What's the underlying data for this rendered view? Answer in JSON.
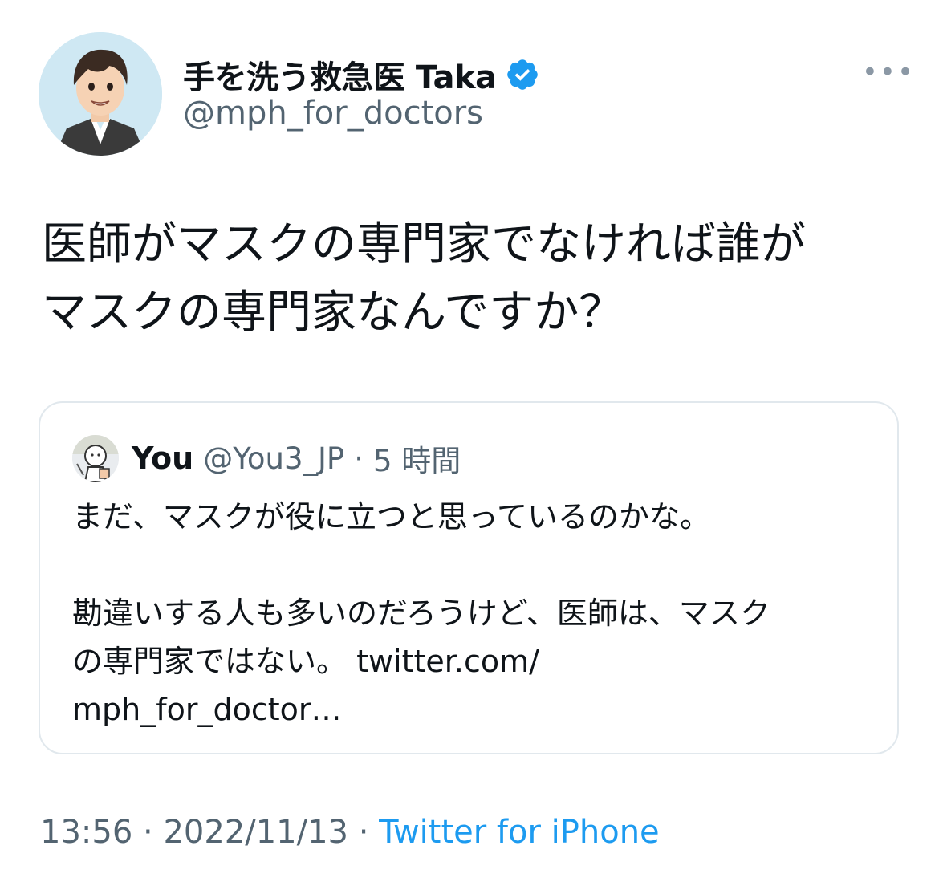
{
  "author": {
    "display_name": "手を洗う救急医 Taka",
    "handle": "@mph_for_doctors",
    "verified": true,
    "avatar_icon": "anime-doctor-avatar"
  },
  "more_label": "•••",
  "tweet": {
    "lines": [
      "医師がマスクの専門家でなければ誰が",
      "マスクの専門家なんですか？"
    ]
  },
  "quote": {
    "name": "You",
    "handle": "@You3_JP",
    "separator": "·",
    "time": "5 時間",
    "paragraph1": "まだ、マスクが役に立つと思っているのかな。",
    "paragraph2_lines": [
      "勘違いする人も多いのだろうけど、医師は、マスク",
      "の専門家ではない。 twitter.com/",
      "mph_for_doctor…"
    ]
  },
  "meta": {
    "time": "13:56",
    "sep1": "·",
    "date": "2022/11/13",
    "sep2": "·",
    "source": "Twitter for iPhone"
  },
  "colors": {
    "verified_blue": "#1d9bf0",
    "link_blue": "#1d9bf0",
    "secondary_text": "#536471"
  }
}
